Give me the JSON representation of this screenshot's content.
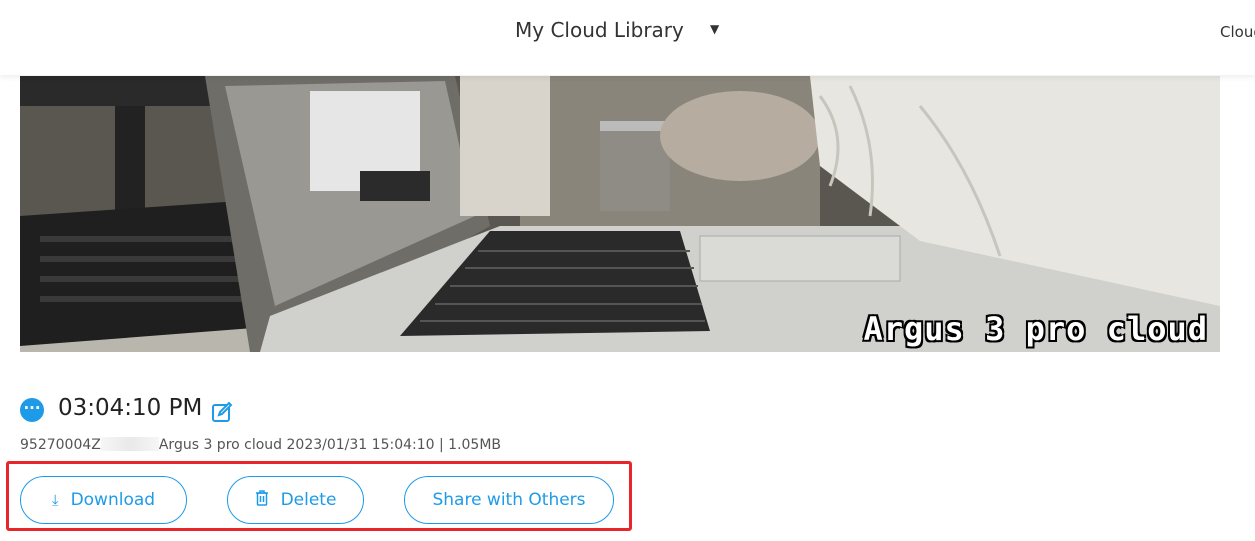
{
  "header": {
    "library_title": "My Cloud Library",
    "right_label": "Cloud"
  },
  "video": {
    "watermark": "Argus 3 pro cloud"
  },
  "clip": {
    "time": "03:04:10 PM",
    "meta_prefix": "95270004Z",
    "meta_suffix": "Argus 3 pro cloud 2023/01/31 15:04:10 | 1.05MB"
  },
  "actions": {
    "download_label": "Download",
    "delete_label": "Delete",
    "share_label": "Share with Others"
  },
  "colors": {
    "accent": "#1e9be8",
    "highlight": "#e8252a"
  },
  "icons": {
    "more": "more-icon",
    "edit": "edit-icon",
    "download": "download-icon",
    "delete": "trash-icon",
    "caret": "caret-down-icon"
  }
}
